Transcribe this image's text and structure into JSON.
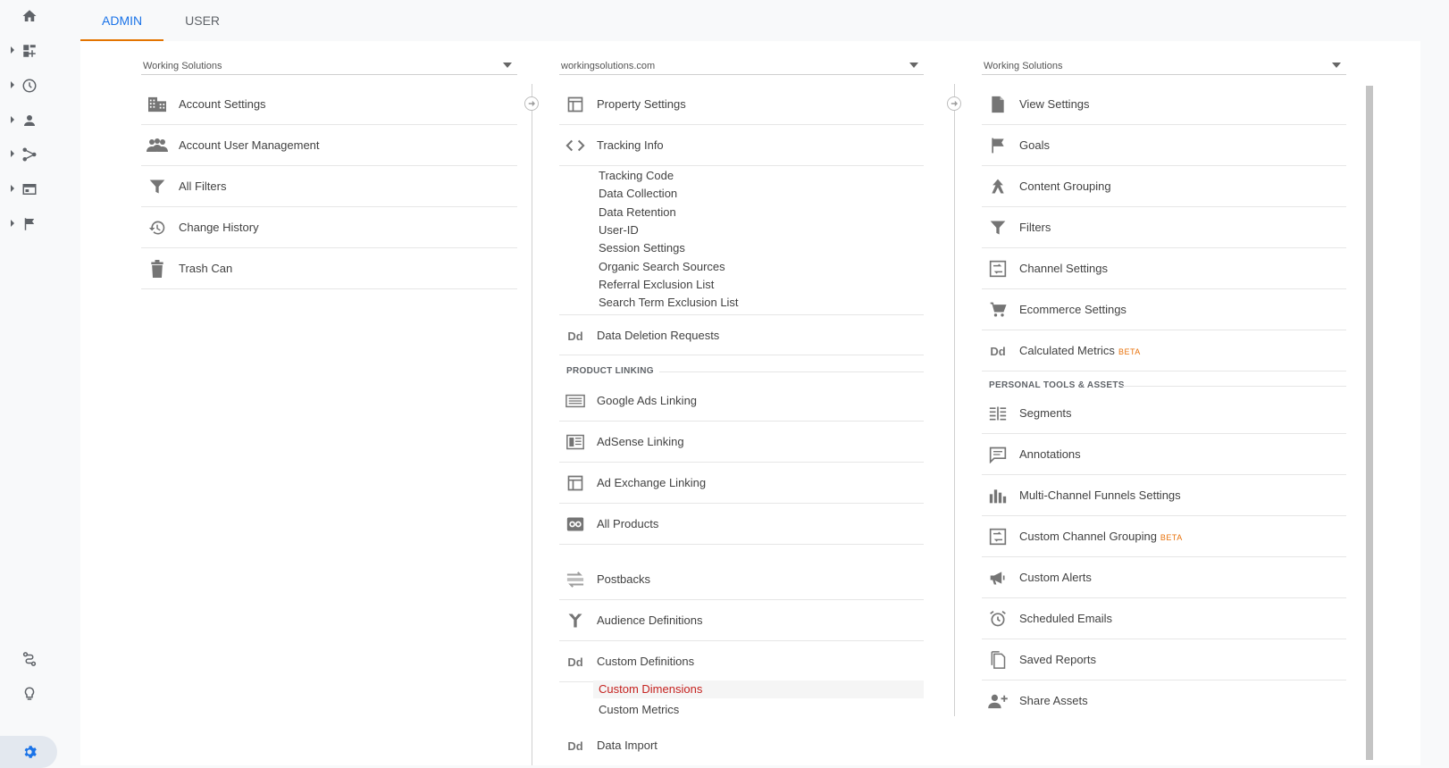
{
  "tabs": [
    {
      "label": "ADMIN",
      "active": true
    },
    {
      "label": "USER",
      "active": false
    }
  ],
  "leftnav": {
    "items": [
      "home-icon",
      "dashboard-icon",
      "clock-icon",
      "person-icon",
      "acquisition-icon",
      "behavior-icon",
      "flag-icon"
    ],
    "bottom": [
      "route-icon",
      "lightbulb-icon",
      "gear-icon"
    ]
  },
  "account": {
    "selector": "Working Solutions",
    "items": [
      {
        "label": "Account Settings",
        "icon": "building-icon"
      },
      {
        "label": "Account User Management",
        "icon": "people-icon"
      },
      {
        "label": "All Filters",
        "icon": "filter-icon"
      },
      {
        "label": "Change History",
        "icon": "history-icon"
      },
      {
        "label": "Trash Can",
        "icon": "trash-icon"
      }
    ]
  },
  "property": {
    "selector": "workingsolutions.com",
    "items": [
      {
        "label": "Property Settings",
        "icon": "layout-icon"
      },
      {
        "label": "Tracking Info",
        "icon": "code-icon"
      }
    ],
    "tracking_sub": [
      "Tracking Code",
      "Data Collection",
      "Data Retention",
      "User-ID",
      "Session Settings",
      "Organic Search Sources",
      "Referral Exclusion List",
      "Search Term Exclusion List"
    ],
    "data_deletion": "Data Deletion Requests",
    "dd_glyph": "Dd",
    "section_product": "PRODUCT LINKING",
    "product_items": [
      {
        "label": "Google Ads Linking",
        "icon": "ads-icon"
      },
      {
        "label": "AdSense Linking",
        "icon": "adsense-icon"
      },
      {
        "label": "Ad Exchange Linking",
        "icon": "adexchange-icon"
      },
      {
        "label": "All Products",
        "icon": "link-icon"
      }
    ],
    "other_items": [
      {
        "label": "Postbacks",
        "icon": "postbacks-icon"
      },
      {
        "label": "Audience Definitions",
        "icon": "audience-icon"
      },
      {
        "label": "Custom Definitions",
        "icon": "dd"
      }
    ],
    "custom_sub": [
      {
        "label": "Custom Dimensions",
        "selected": true
      },
      {
        "label": "Custom Metrics",
        "selected": false
      }
    ],
    "cut_item": "Data Import"
  },
  "view": {
    "selector": "Working Solutions",
    "items": [
      {
        "label": "View Settings",
        "icon": "document-icon"
      },
      {
        "label": "Goals",
        "icon": "flag-icon"
      },
      {
        "label": "Content Grouping",
        "icon": "content-grouping-icon"
      },
      {
        "label": "Filters",
        "icon": "filter-icon"
      },
      {
        "label": "Channel Settings",
        "icon": "channel-icon"
      },
      {
        "label": "Ecommerce Settings",
        "icon": "cart-icon"
      },
      {
        "label": "Calculated Metrics",
        "icon": "dd",
        "beta": "BETA"
      }
    ],
    "section_personal": "PERSONAL TOOLS & ASSETS",
    "personal_items": [
      {
        "label": "Segments",
        "icon": "segments-icon"
      },
      {
        "label": "Annotations",
        "icon": "annotation-icon"
      },
      {
        "label": "Multi-Channel Funnels Settings",
        "icon": "bar-chart-icon"
      },
      {
        "label": "Custom Channel Grouping",
        "icon": "channel-icon",
        "beta": "BETA"
      },
      {
        "label": "Custom Alerts",
        "icon": "megaphone-icon"
      },
      {
        "label": "Scheduled Emails",
        "icon": "alarm-icon"
      },
      {
        "label": "Saved Reports",
        "icon": "saved-reports-icon"
      },
      {
        "label": "Share Assets",
        "icon": "share-user-icon"
      }
    ]
  }
}
